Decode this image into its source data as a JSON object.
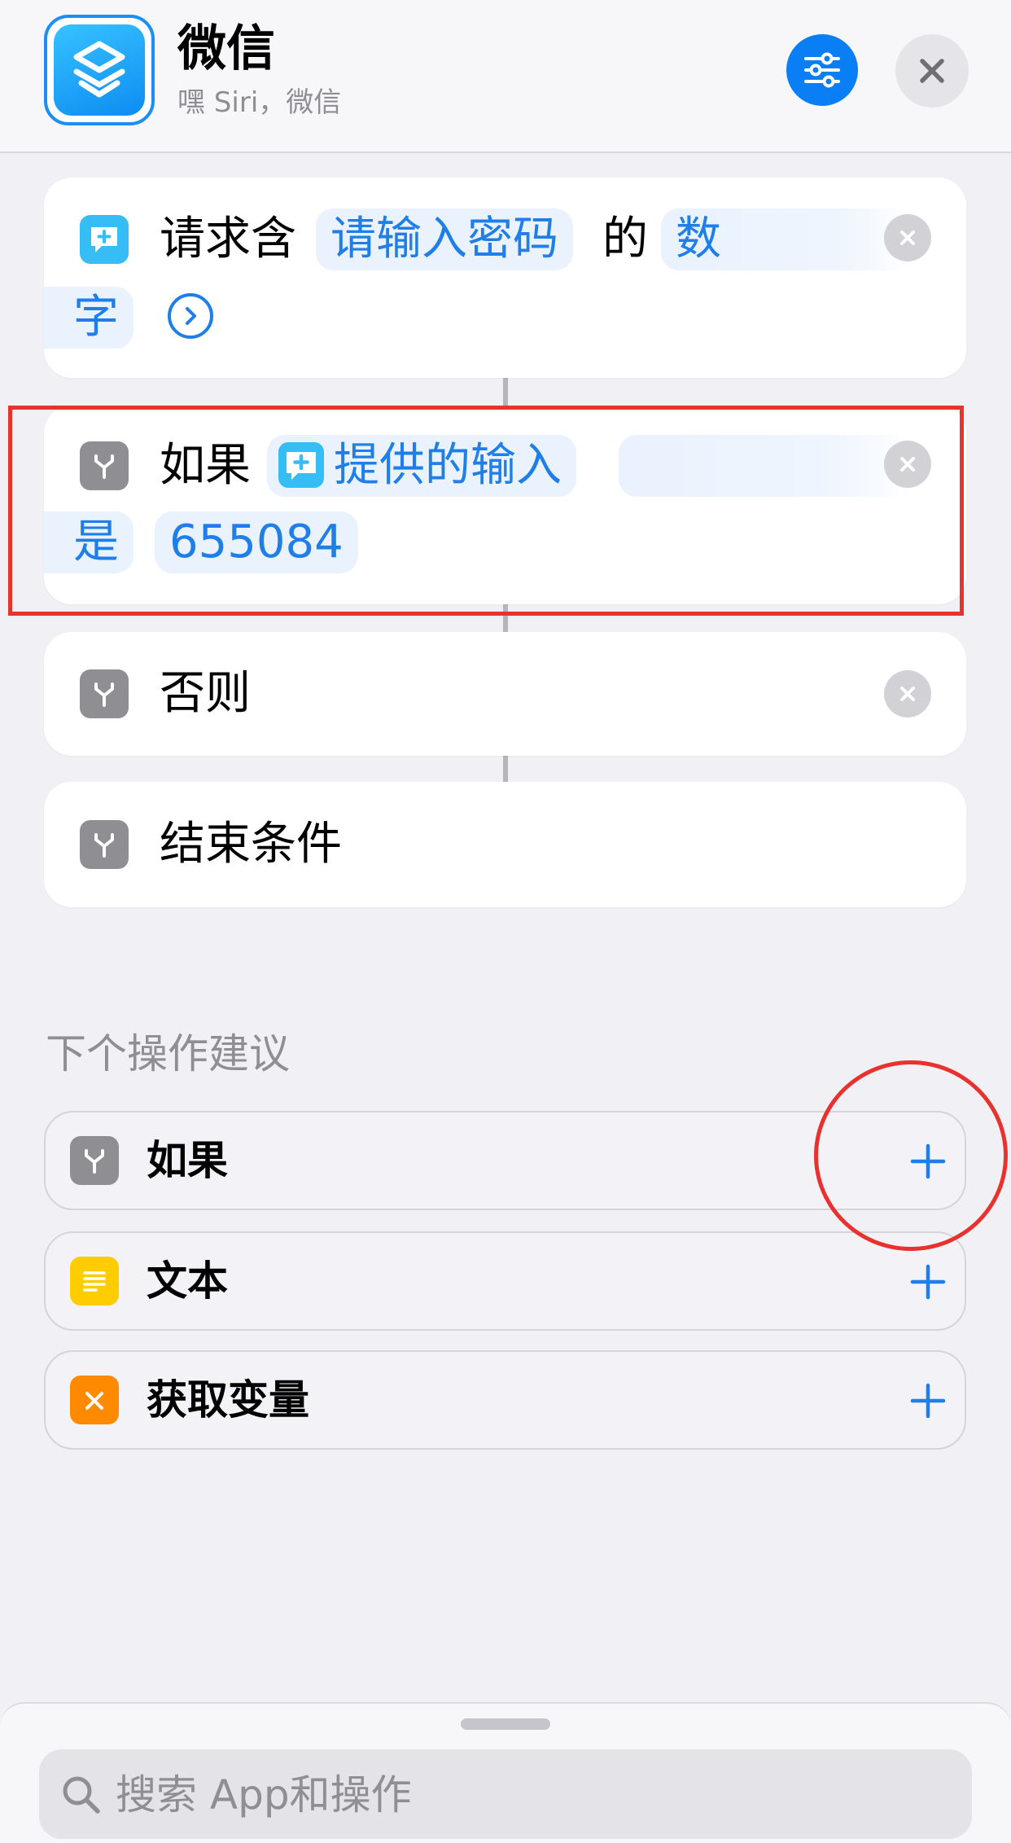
{
  "header": {
    "title": "微信",
    "subtitle": "嘿 Siri，微信",
    "app_icon": "shortcuts-icon",
    "settings_icon": "sliders-icon",
    "close_icon": "close-icon"
  },
  "actions": {
    "ask_input": {
      "prefix": "请求含",
      "prompt": "请输入密码",
      "middle": "的",
      "type_part1": "数",
      "type_part2": "字",
      "icon": "speech-bubble-plus-icon"
    },
    "if_block": {
      "label": "如果",
      "variable": "提供的输入",
      "condition": "是",
      "value": "655084",
      "icon": "branch-icon"
    },
    "otherwise": {
      "label": "否则",
      "icon": "branch-icon"
    },
    "end_if": {
      "label": "结束条件",
      "icon": "branch-icon"
    }
  },
  "suggestions": {
    "title": "下个操作建议",
    "items": [
      {
        "label": "如果",
        "icon": "branch-icon",
        "color": "#8e8e93"
      },
      {
        "label": "文本",
        "icon": "text-lines-icon",
        "color": "#ffcc00"
      },
      {
        "label": "获取变量",
        "icon": "variable-x-icon",
        "color": "#ff8a00"
      }
    ]
  },
  "search": {
    "placeholder": "搜索 App和操作"
  },
  "colors": {
    "accent": "#0a7ff5",
    "token_text": "#1f7ee8",
    "annotation_red": "#e8322e",
    "background": "#f0f0f5"
  }
}
